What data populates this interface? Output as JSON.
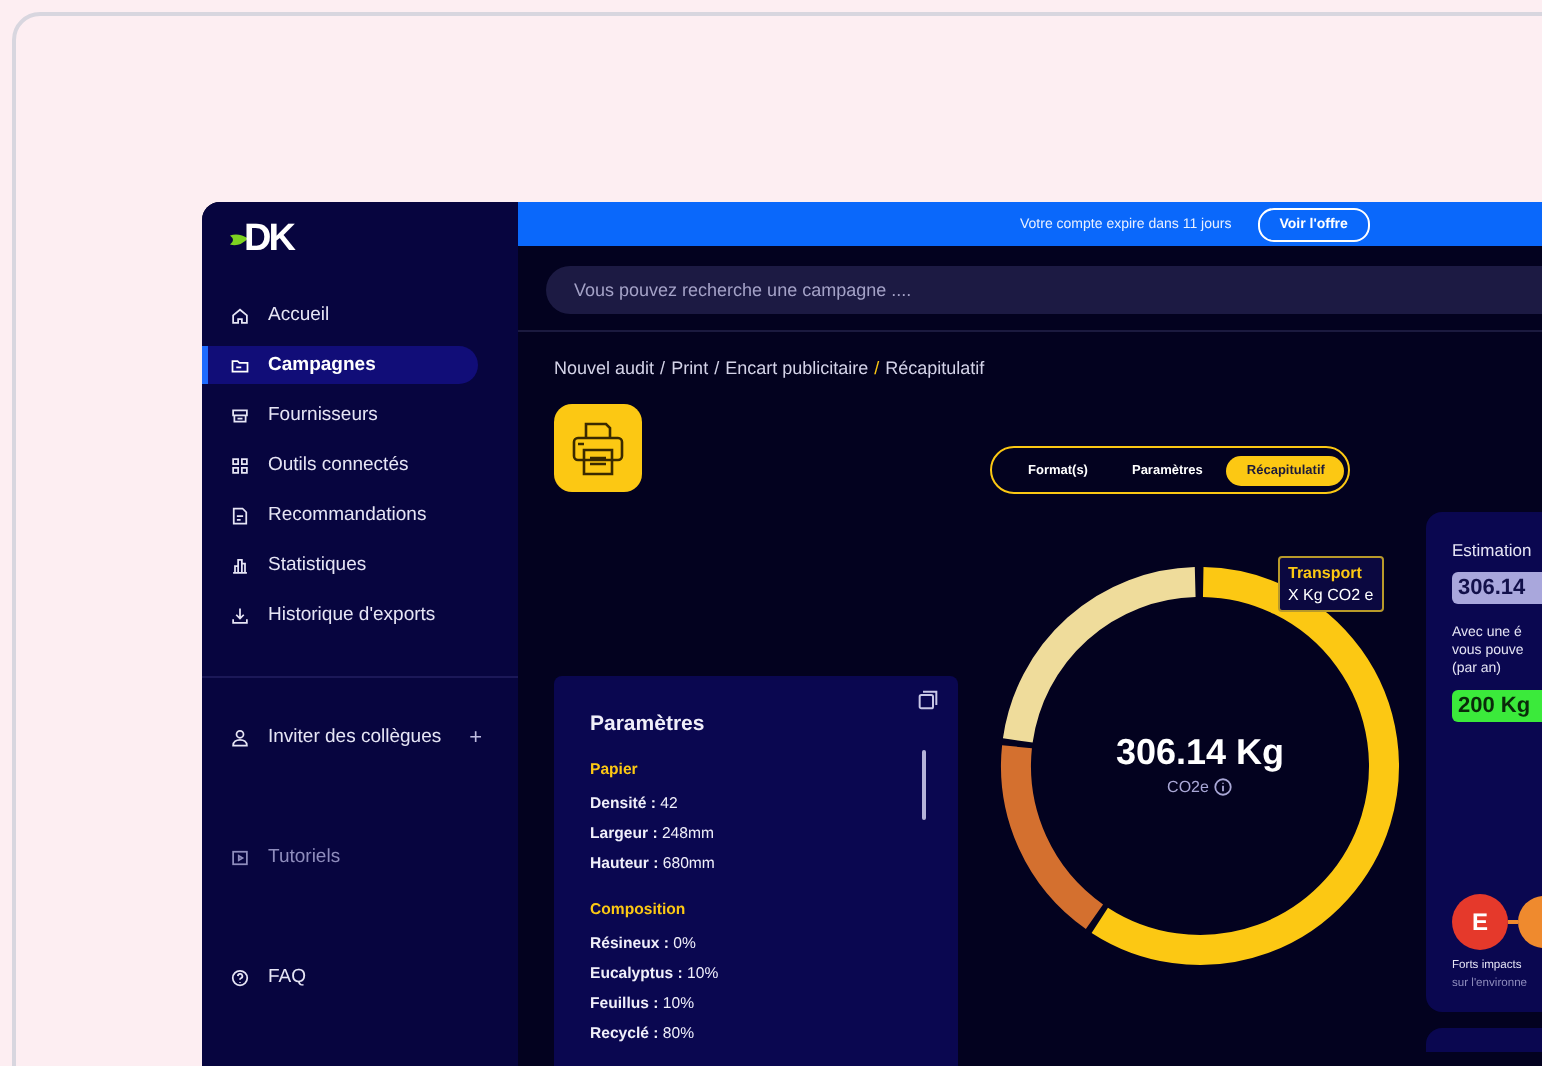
{
  "sidebar": {
    "logo": "DK",
    "items": [
      {
        "label": "Accueil",
        "selected": false
      },
      {
        "label": "Campagnes",
        "selected": true
      },
      {
        "label": "Fournisseurs",
        "selected": false
      },
      {
        "label": "Outils connectés",
        "selected": false
      },
      {
        "label": "Recommandations",
        "selected": false
      },
      {
        "label": "Statistiques",
        "selected": false
      },
      {
        "label": "Historique d'exports",
        "selected": false
      }
    ],
    "invite": {
      "label": "Inviter des collègues",
      "action": "+"
    },
    "footer_items": [
      {
        "label": "Tutoriels",
        "disabled": true
      },
      {
        "label": "FAQ",
        "disabled": false
      }
    ]
  },
  "banner": {
    "text": "Votre compte expire dans 11 jours",
    "button": "Voir l'offre"
  },
  "search": {
    "placeholder": "Vous pouvez recherche une campagne ...."
  },
  "breadcrumb": {
    "items": [
      "Nouvel audit",
      "Print",
      "Encart publicitaire",
      "Récapitulatif"
    ],
    "separator": "/"
  },
  "tabs": [
    {
      "label": "Format(s)",
      "selected": false
    },
    {
      "label": "Paramètres",
      "selected": false
    },
    {
      "label": "Récapitulatif",
      "selected": true
    }
  ],
  "parameters": {
    "title": "Paramètres",
    "sections": [
      {
        "heading": "Papier",
        "rows": [
          "**Densité :** 42",
          "**Largeur :** 248mm",
          "**Hauteur :** 680mm"
        ]
      },
      {
        "heading": "Composition",
        "rows": [
          "**Résineux :** 0%",
          "**Eucalyptus :** 10%",
          "**Feuillus :** 10%",
          "**Recyclé :** 80%"
        ]
      }
    ]
  },
  "total": {
    "value": "306.14 Kg",
    "unit": "CO2e"
  },
  "tooltip": {
    "title": "Transport",
    "value": "X Kg CO2 e"
  },
  "estimation": {
    "title": "Estimation",
    "value": "306.14",
    "text_lines": [
      "Avec une é",
      "vous pouve",
      "(par an)"
    ],
    "saving": "200 Kg",
    "grades": [
      {
        "label": "E",
        "color": "#e5392b"
      },
      {
        "color": "#ef8a2e"
      }
    ],
    "legend_lines": [
      "Forts impacts",
      "sur l'environne"
    ]
  }
}
